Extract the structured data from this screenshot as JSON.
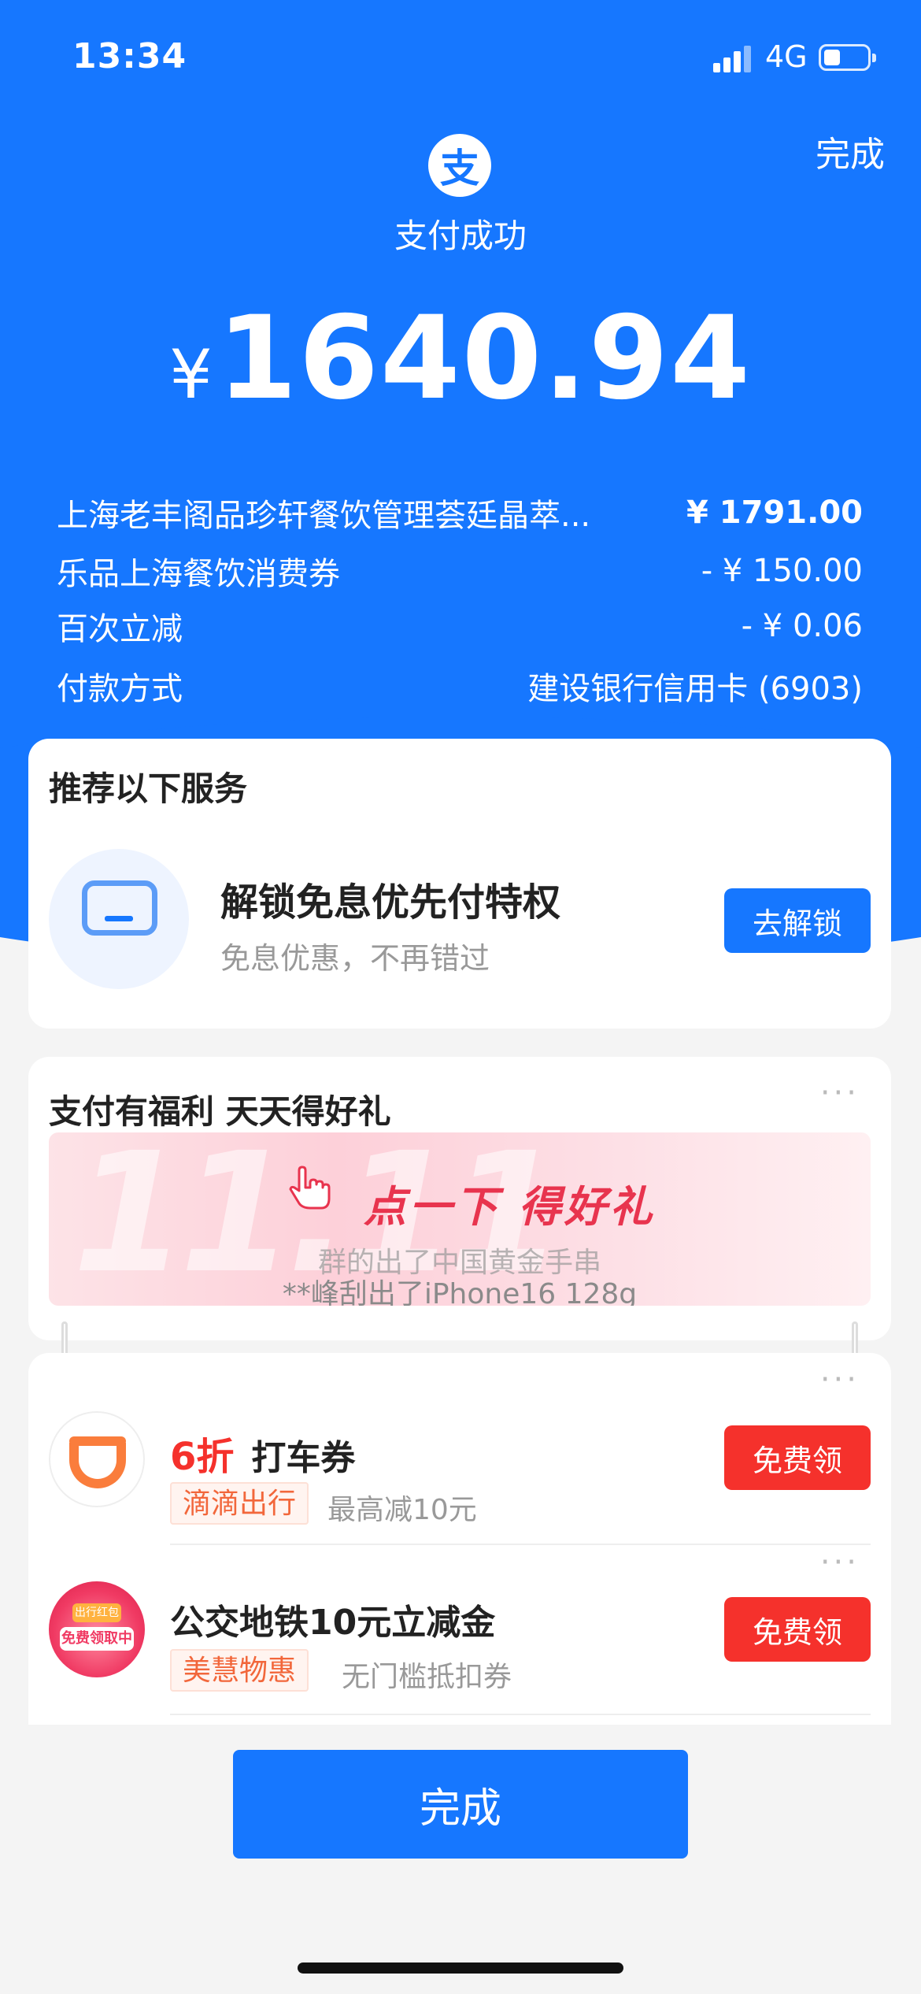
{
  "status_bar": {
    "time": "13:34",
    "network": "4G"
  },
  "header": {
    "done_label": "完成",
    "logo_char": "支",
    "title": "支付成功",
    "currency": "¥",
    "amount": "1640.94"
  },
  "details": [
    {
      "label": "上海老丰阁品珍轩餐饮管理荟廷晶萃...",
      "value": "¥ 1791.00"
    },
    {
      "label": "乐品上海餐饮消费券",
      "value": "- ¥ 150.00"
    },
    {
      "label": "百次立减",
      "value": "- ¥ 0.06"
    },
    {
      "label": "付款方式",
      "value": "建设银行信用卡 (6903)"
    }
  ],
  "recommend": {
    "title": "推荐以下服务",
    "service_title": "解锁免息优先付特权",
    "service_sub": "免息优惠，不再错过",
    "button": "去解锁"
  },
  "welfare": {
    "title": "支付有福利 天天得好礼",
    "more": "···",
    "banner_text": "点一下 得好礼",
    "banner_bg_text": "11.11",
    "ticker_line1": "群的出了中国黄金手串",
    "ticker_line2": "**峰刮出了iPhone16 128g"
  },
  "offers": [
    {
      "discount": "6折",
      "title": "打车券",
      "tag": "滴滴出行",
      "sub": "最高减10元",
      "button": "免费领",
      "more": "···"
    },
    {
      "discount": "",
      "title": "公交地铁10元立减金",
      "tag": "美慧物惠",
      "sub": "无门槛抵扣券",
      "button": "免费领",
      "more": "···",
      "logo_text_1": "出行红包",
      "logo_text_2": "免费领取中"
    }
  ],
  "footer": {
    "done_button": "完成"
  },
  "colors": {
    "primary": "#1677ff",
    "red": "#f5312c",
    "orange_tag": "#f2673b"
  }
}
